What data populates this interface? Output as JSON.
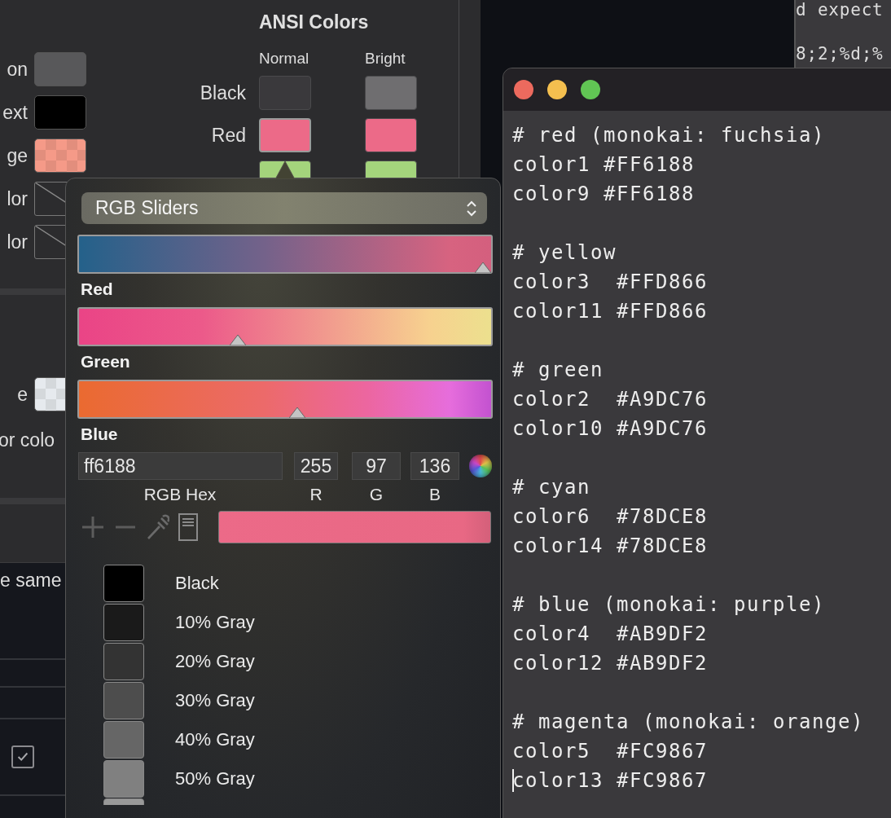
{
  "settings_panel": {
    "left_rows": [
      {
        "label": "on",
        "kind": "solid",
        "color": "#58585a"
      },
      {
        "label": "ext",
        "kind": "solid",
        "color": "#000000"
      },
      {
        "label": "ge",
        "kind": "checker",
        "color": "#f59a88"
      },
      {
        "label": "lor",
        "kind": "none"
      },
      {
        "label": "lor",
        "kind": "none"
      }
    ],
    "lower_rows": [
      {
        "label": "e",
        "kind": "checker",
        "color": "#e6eaee"
      },
      {
        "label": "or colo",
        "kind": "text"
      }
    ],
    "ansi": {
      "title": "ANSI Colors",
      "columns": [
        "Normal",
        "Bright"
      ],
      "rows": [
        {
          "label": "Black",
          "wells": [
            {
              "color": "#3a393c"
            },
            {
              "color": "#6f6e70"
            }
          ]
        },
        {
          "label": "Red",
          "selected": true,
          "wells": [
            {
              "color": "#ec6a88"
            },
            {
              "color": "#ec6a88"
            }
          ]
        },
        {
          "selected": false,
          "wells": [
            {
              "color": "#a4d47c"
            },
            {
              "color": "#a4d47c"
            }
          ]
        }
      ]
    },
    "bottom": {
      "text": "e same",
      "checkbox": {
        "checked": true
      }
    }
  },
  "background_terminal": {
    "lines": [
      "d expect",
      "8;2;%d;%"
    ]
  },
  "color_picker": {
    "mode": "RGB Sliders",
    "sliders": [
      {
        "label": "Red",
        "level": 1.0
      },
      {
        "label": "Green",
        "level": 0.38
      },
      {
        "label": "Blue",
        "level": 0.53
      }
    ],
    "hex": {
      "value": "ff6188",
      "label": "RGB Hex"
    },
    "channels": [
      {
        "value": "255",
        "label": "R"
      },
      {
        "value": "97",
        "label": "G"
      },
      {
        "value": "136",
        "label": "B"
      }
    ],
    "swatches": [
      {
        "name": "Black",
        "color": "#000000"
      },
      {
        "name": "10% Gray",
        "color": "#1a1a1a"
      },
      {
        "name": "20% Gray",
        "color": "#333333"
      },
      {
        "name": "30% Gray",
        "color": "#4d4d4d"
      },
      {
        "name": "40% Gray",
        "color": "#666666"
      },
      {
        "name": "50% Gray",
        "color": "#808080"
      }
    ]
  },
  "terminal": {
    "blocks": [
      {
        "comment": "# red (monokai: fuchsia)",
        "lines": [
          {
            "text": "color1 #FF6188",
            "cursor": false
          },
          {
            "text": "color9 #FF6188",
            "cursor": false
          }
        ]
      },
      {
        "comment": "# yellow",
        "lines": [
          {
            "text": "color3  #FFD866",
            "cursor": false
          },
          {
            "text": "color11 #FFD866",
            "cursor": false
          }
        ]
      },
      {
        "comment": "# green",
        "lines": [
          {
            "text": "color2  #A9DC76",
            "cursor": false
          },
          {
            "text": "color10 #A9DC76",
            "cursor": false
          }
        ]
      },
      {
        "comment": "# cyan",
        "lines": [
          {
            "text": "color6  #78DCE8",
            "cursor": false
          },
          {
            "text": "color14 #78DCE8",
            "cursor": false
          }
        ]
      },
      {
        "comment": "# blue (monokai: purple)",
        "lines": [
          {
            "text": "color4  #AB9DF2",
            "cursor": false
          },
          {
            "text": "color12 #AB9DF2",
            "cursor": false
          }
        ]
      },
      {
        "comment": "# magenta (monokai: orange)",
        "lines": [
          {
            "text": "color5  #FC9867",
            "cursor": false
          },
          {
            "text": "color13 #FC9867",
            "cursor": true
          }
        ]
      }
    ]
  }
}
